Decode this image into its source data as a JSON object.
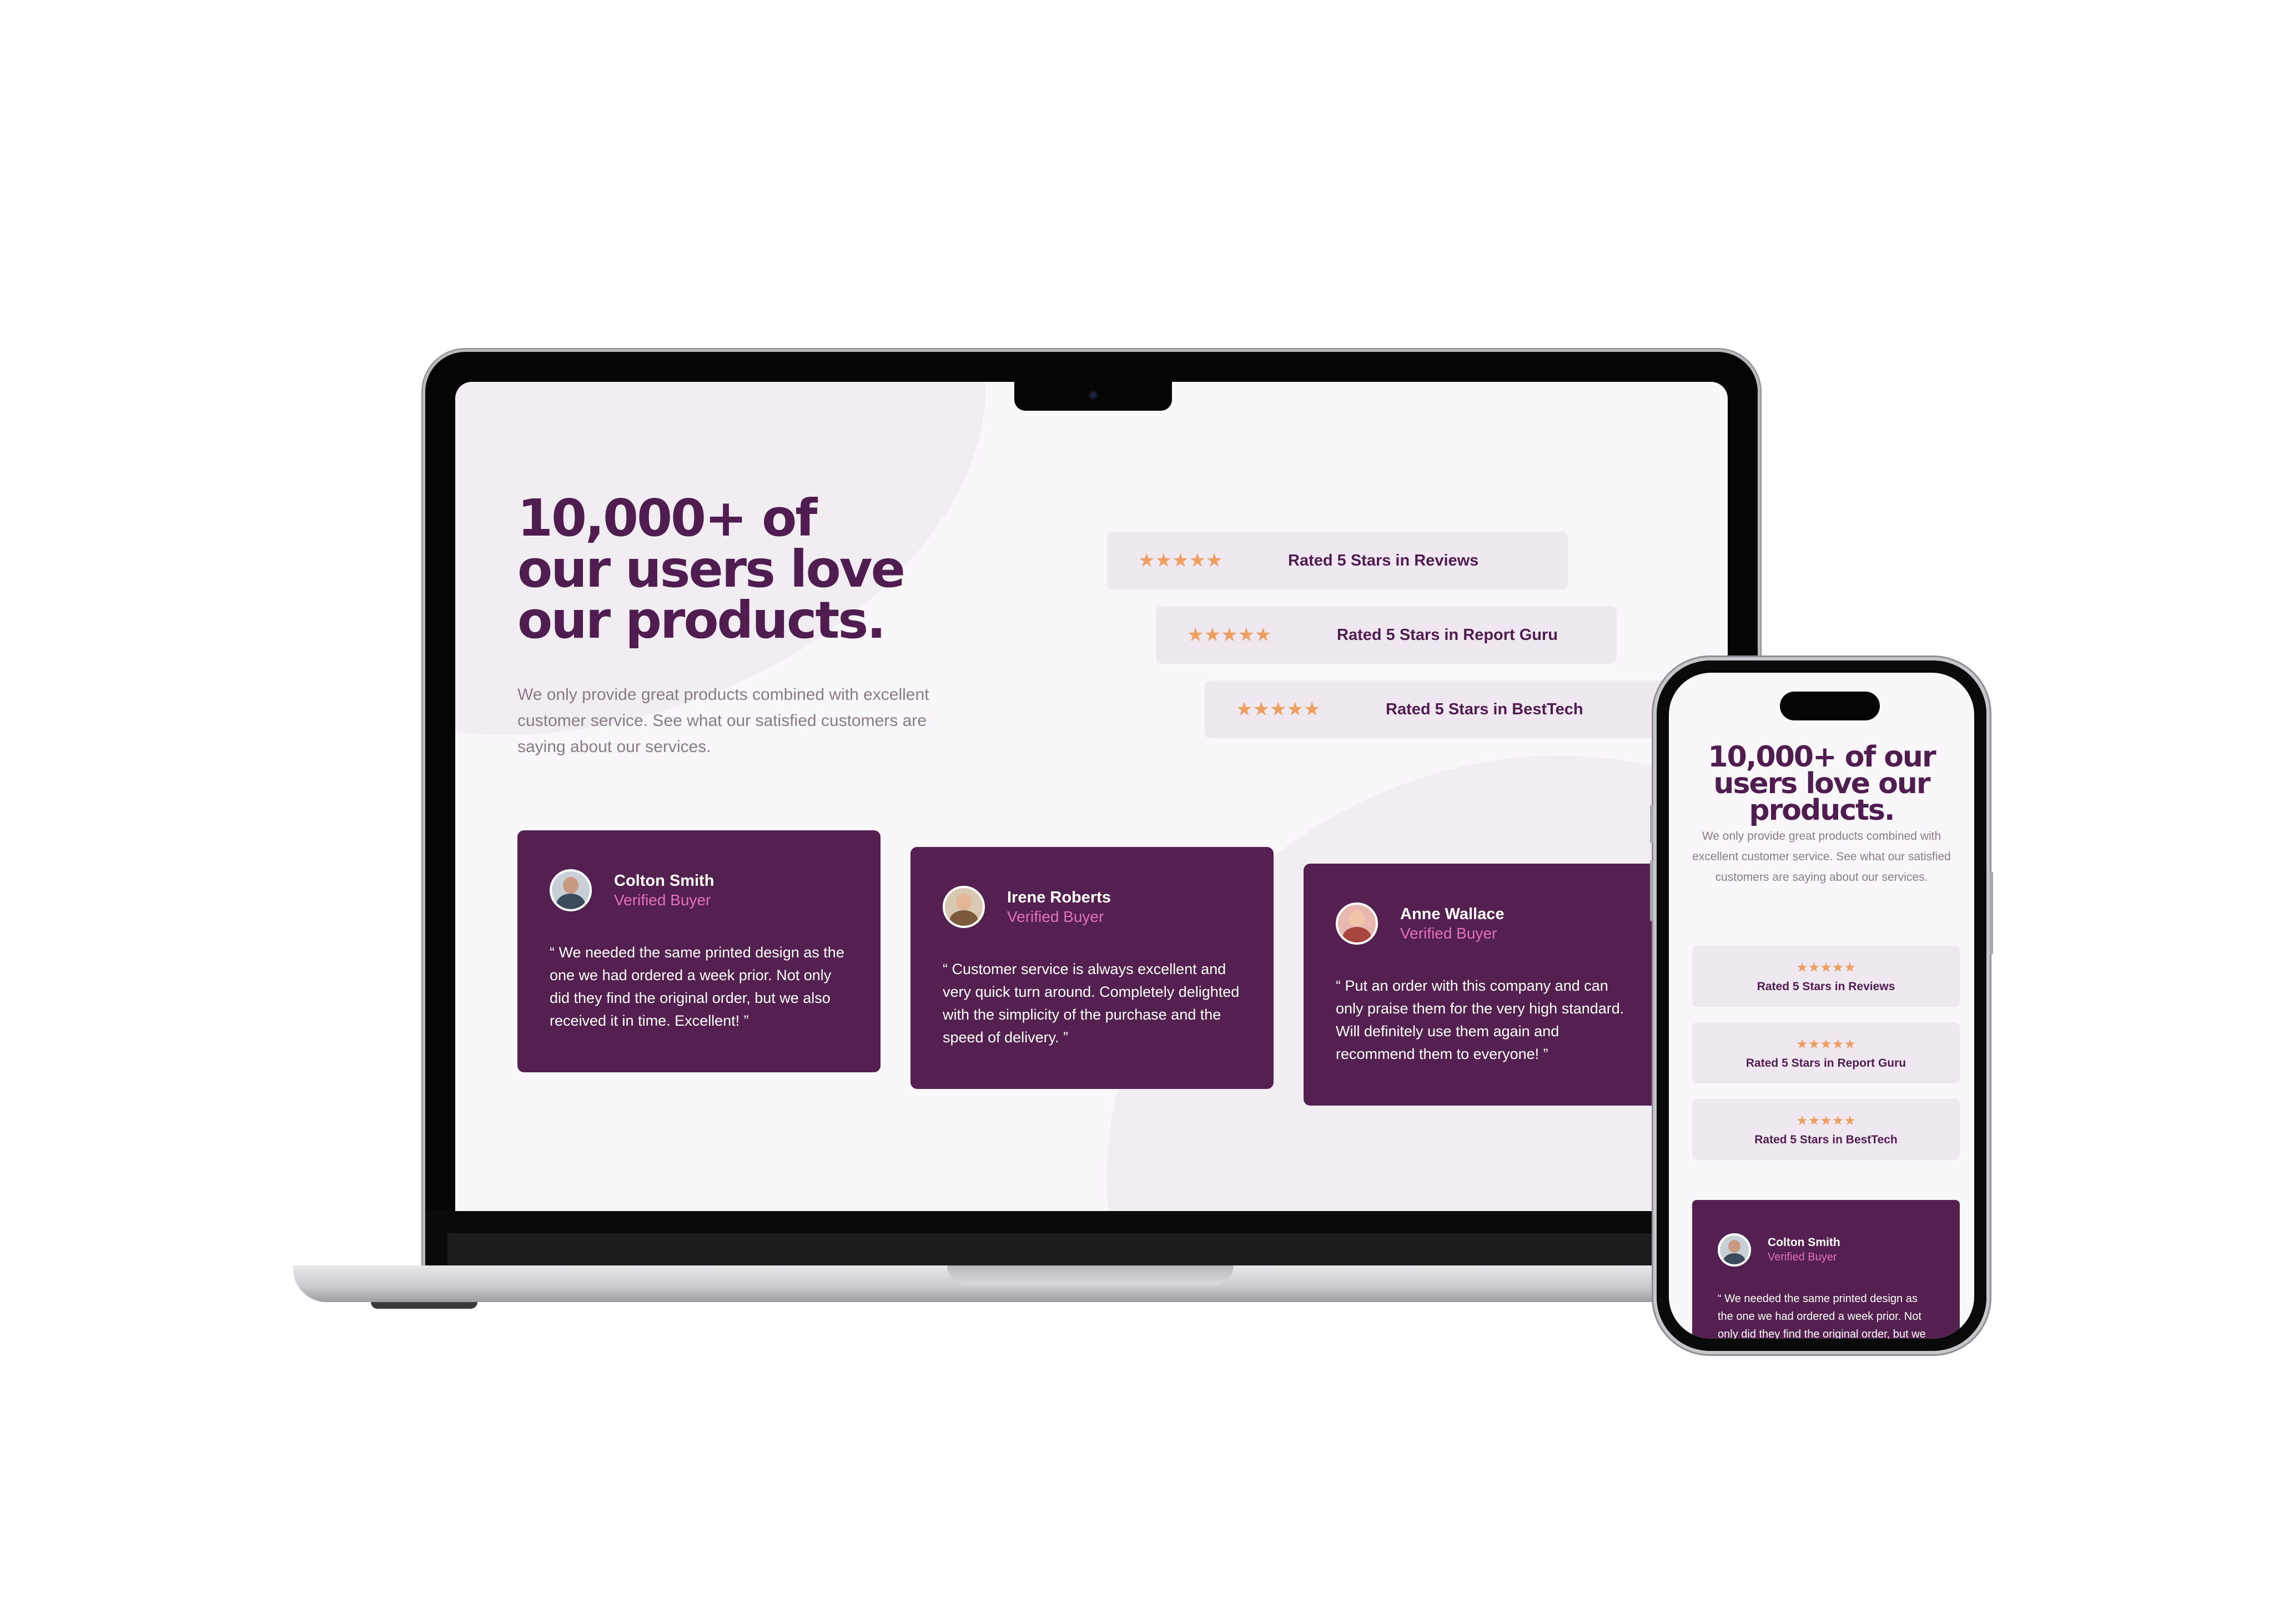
{
  "hero": {
    "heading": "10,000+ of our users love our products.",
    "description": "We only provide great products combined with excellent customer service. See what our satisfied customers are saying about our services."
  },
  "ratings": [
    {
      "stars": "★★★★★",
      "label": "Rated 5 Stars in Reviews",
      "star_count": 5
    },
    {
      "stars": "★★★★★",
      "label": "Rated 5 Stars in Report Guru",
      "star_count": 5
    },
    {
      "stars": "★★★★★",
      "label": "Rated 5 Stars in BestTech",
      "star_count": 5
    }
  ],
  "testimonials": [
    {
      "name": "Colton Smith",
      "role": "Verified Buyer",
      "quote": "“ We needed the same printed design as the one we had ordered a week prior. Not only did they find the original order, but we also received it in time. Excellent! ”"
    },
    {
      "name": "Irene Roberts",
      "role": "Verified Buyer",
      "quote": "“ Customer service is always excellent and very quick turn around. Completely delighted with the simplicity of the purchase and the speed of delivery. ”"
    },
    {
      "name": "Anne Wallace",
      "role": "Verified Buyer",
      "quote": "“ Put an order with this company and can only praise them for the very high standard. Will definitely use them again and recommend them to everyone! ”"
    }
  ],
  "icons": {
    "star": "star-icon",
    "avatar": "avatar"
  },
  "colors": {
    "primary": "#53204f",
    "heading": "#4f1d4f",
    "accent_pink": "#e371bd",
    "star": "#ee9e5e",
    "rating_bg": "#f0e8f1",
    "page_bg": "#faf7fb",
    "body_text": "#8a798a"
  }
}
